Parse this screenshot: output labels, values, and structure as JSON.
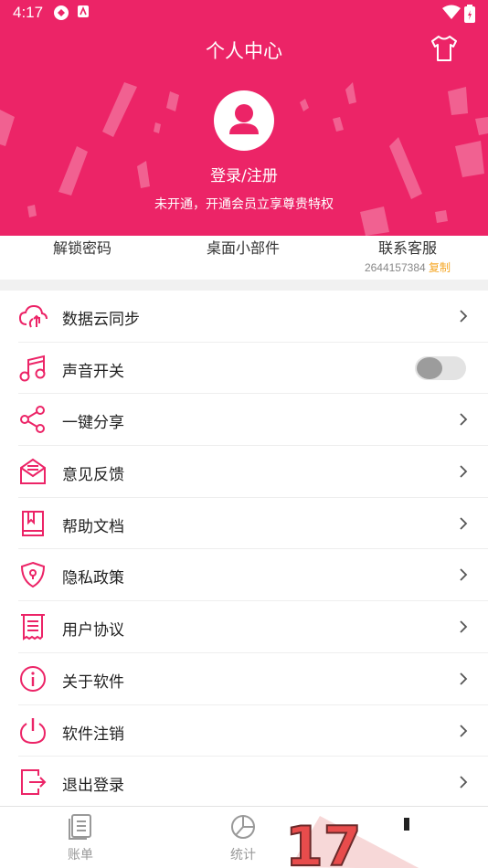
{
  "status_bar": {
    "time": "4:17"
  },
  "header": {
    "title": "个人中心",
    "login_text": "登录/注册",
    "vip_text": "未开通，开通会员立享尊贵特权",
    "accent_color": "#ec2467"
  },
  "quick_actions": [
    {
      "label": "解锁密码"
    },
    {
      "label": "桌面小部件"
    },
    {
      "label": "联系客服",
      "phone": "2644157384",
      "copy_label": "复制"
    }
  ],
  "menu": [
    {
      "label": "数据云同步",
      "icon": "cloud-sync-icon",
      "control": "chevron"
    },
    {
      "label": "声音开关",
      "icon": "music-note-icon",
      "control": "toggle",
      "toggle_on": false
    },
    {
      "label": "一键分享",
      "icon": "share-icon",
      "control": "chevron"
    },
    {
      "label": "意见反馈",
      "icon": "mail-feedback-icon",
      "control": "chevron"
    },
    {
      "label": "帮助文档",
      "icon": "book-icon",
      "control": "chevron"
    },
    {
      "label": "隐私政策",
      "icon": "shield-icon",
      "control": "chevron"
    },
    {
      "label": "用户协议",
      "icon": "document-icon",
      "control": "chevron"
    },
    {
      "label": "关于软件",
      "icon": "info-icon",
      "control": "chevron"
    },
    {
      "label": "软件注销",
      "icon": "power-icon",
      "control": "chevron"
    },
    {
      "label": "退出登录",
      "icon": "logout-icon",
      "control": "chevron"
    }
  ],
  "tabbar": [
    {
      "label": "账单",
      "icon": "bill-icon"
    },
    {
      "label": "统计",
      "icon": "pie-chart-icon"
    }
  ],
  "badge_text": "17"
}
